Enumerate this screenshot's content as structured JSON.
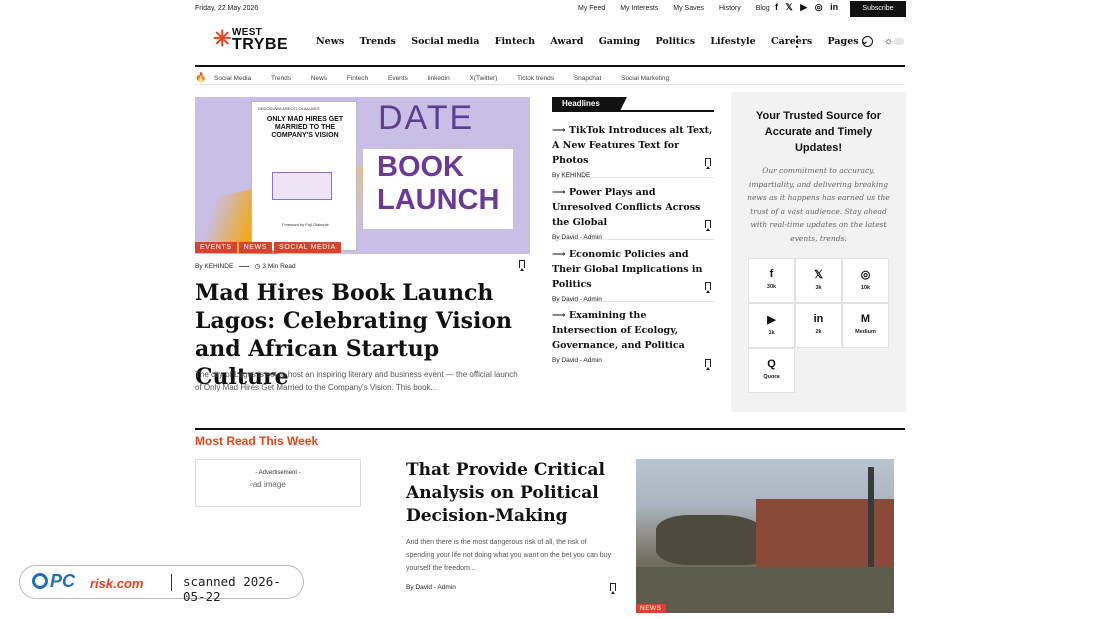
{
  "topbar": {
    "date": "Friday, 22 May 2026",
    "links": [
      "My Feed",
      "My Interests",
      "My Saves",
      "History",
      "Blog"
    ],
    "social_icons": [
      "facebook-icon",
      "x-icon",
      "youtube-icon",
      "instagram-icon",
      "linkedin-icon"
    ],
    "social_glyphs": [
      "f",
      "𝕏",
      "▶",
      "◎",
      "in"
    ],
    "subscribe_label": "Subscribe"
  },
  "header": {
    "logo_line1": "WEST",
    "logo_line2": "TRYBE",
    "nav": [
      "News",
      "Trends",
      "Social media",
      "Fintech",
      "Award",
      "Gaming",
      "Politics",
      "Lifestyle",
      "Careers",
      "Pages"
    ],
    "pages_chevron": "⌄",
    "more_glyph": "⋮",
    "theme_glyph": "☼"
  },
  "trending": {
    "icon": "fire-icon",
    "items": [
      "Social Media",
      "Trends",
      "News",
      "Fintech",
      "Events",
      "linkedin",
      "X(Twitter)",
      "Tictok trends",
      "Snapchat",
      "Social Marketing"
    ]
  },
  "hero": {
    "image_text": {
      "poster_subtitle": "DEDODUWA AREOTI-OLAKUNLE",
      "poster_title": "ONLY MAD HIRES GET MARRIED TO THE COMPANY'S VISION",
      "poster_footer": "Foreword by Fuji Olakunle",
      "date_word": "DATE",
      "book_word": "BOOK",
      "launch_word": "LAUNCH"
    },
    "tags": [
      "EVENTS",
      "NEWS",
      "SOCIAL MEDIA"
    ],
    "author": "By KEHINDE",
    "read_time": "3 Min Read",
    "title": "Mad Hires Book Launch Lagos: Celebrating Vision and African Startup Culture",
    "excerpt": "The city of Lagos is set to host an inspiring literary and business event — the official launch of Only Mad Hires Get Married to the Company's Vision. This book..."
  },
  "headlines": {
    "label": "Headlines",
    "items": [
      {
        "title": "TikTok Introduces alt Text, A New Features Text for Photos",
        "author": "By KEHINDE"
      },
      {
        "title": "Power Plays and Unresolved Conflicts Across the Global",
        "author": "By David - Admin"
      },
      {
        "title": "Economic Policies and Their Global Implications in Politics",
        "author": "By David - Admin"
      },
      {
        "title": "Examining the Intersection of Ecology, Governance, and Politica",
        "author": "By David - Admin"
      }
    ]
  },
  "sidebar": {
    "title": "Your Trusted Source for Accurate and Timely Updates!",
    "description": "Our commitment to accuracy, impartiality, and delivering breaking news as it happens has earned us the trust of a vast audience. Stay ahead with real-time updates on the latest events, trends.",
    "social": [
      {
        "icon": "facebook-icon",
        "glyph": "f",
        "count": "30k"
      },
      {
        "icon": "x-icon",
        "glyph": "𝕏",
        "count": "3k"
      },
      {
        "icon": "instagram-icon",
        "glyph": "◎",
        "count": "10k"
      },
      {
        "icon": "youtube-icon",
        "glyph": "▶",
        "count": "1k"
      },
      {
        "icon": "linkedin-icon",
        "glyph": "in",
        "count": "2k"
      },
      {
        "icon": "medium-icon",
        "glyph": "M",
        "count": "Medium"
      },
      {
        "icon": "quora-icon",
        "glyph": "Q",
        "count": "Quora"
      }
    ]
  },
  "most_read": {
    "title": "Most Read This Week",
    "ad_label": "- Advertisement -",
    "ad_image_alt": "ad image",
    "article_title": "That Provide Critical Analysis on Political Decision-Making",
    "article_excerpt": "And then there is the most dangerous risk of all, the risk of spending your life not doing what you want on the bet you can buy yourself the freedom...",
    "article_author": "By David - Admin",
    "photo_tag": "NEWS"
  },
  "watermark": {
    "brand_pc": "PC",
    "brand_risk": "risk.com",
    "scan_text": "scanned 2026-05-22"
  },
  "colors": {
    "accent": "#e8431c",
    "tag_red": "#d8432f",
    "dark": "#111111"
  }
}
